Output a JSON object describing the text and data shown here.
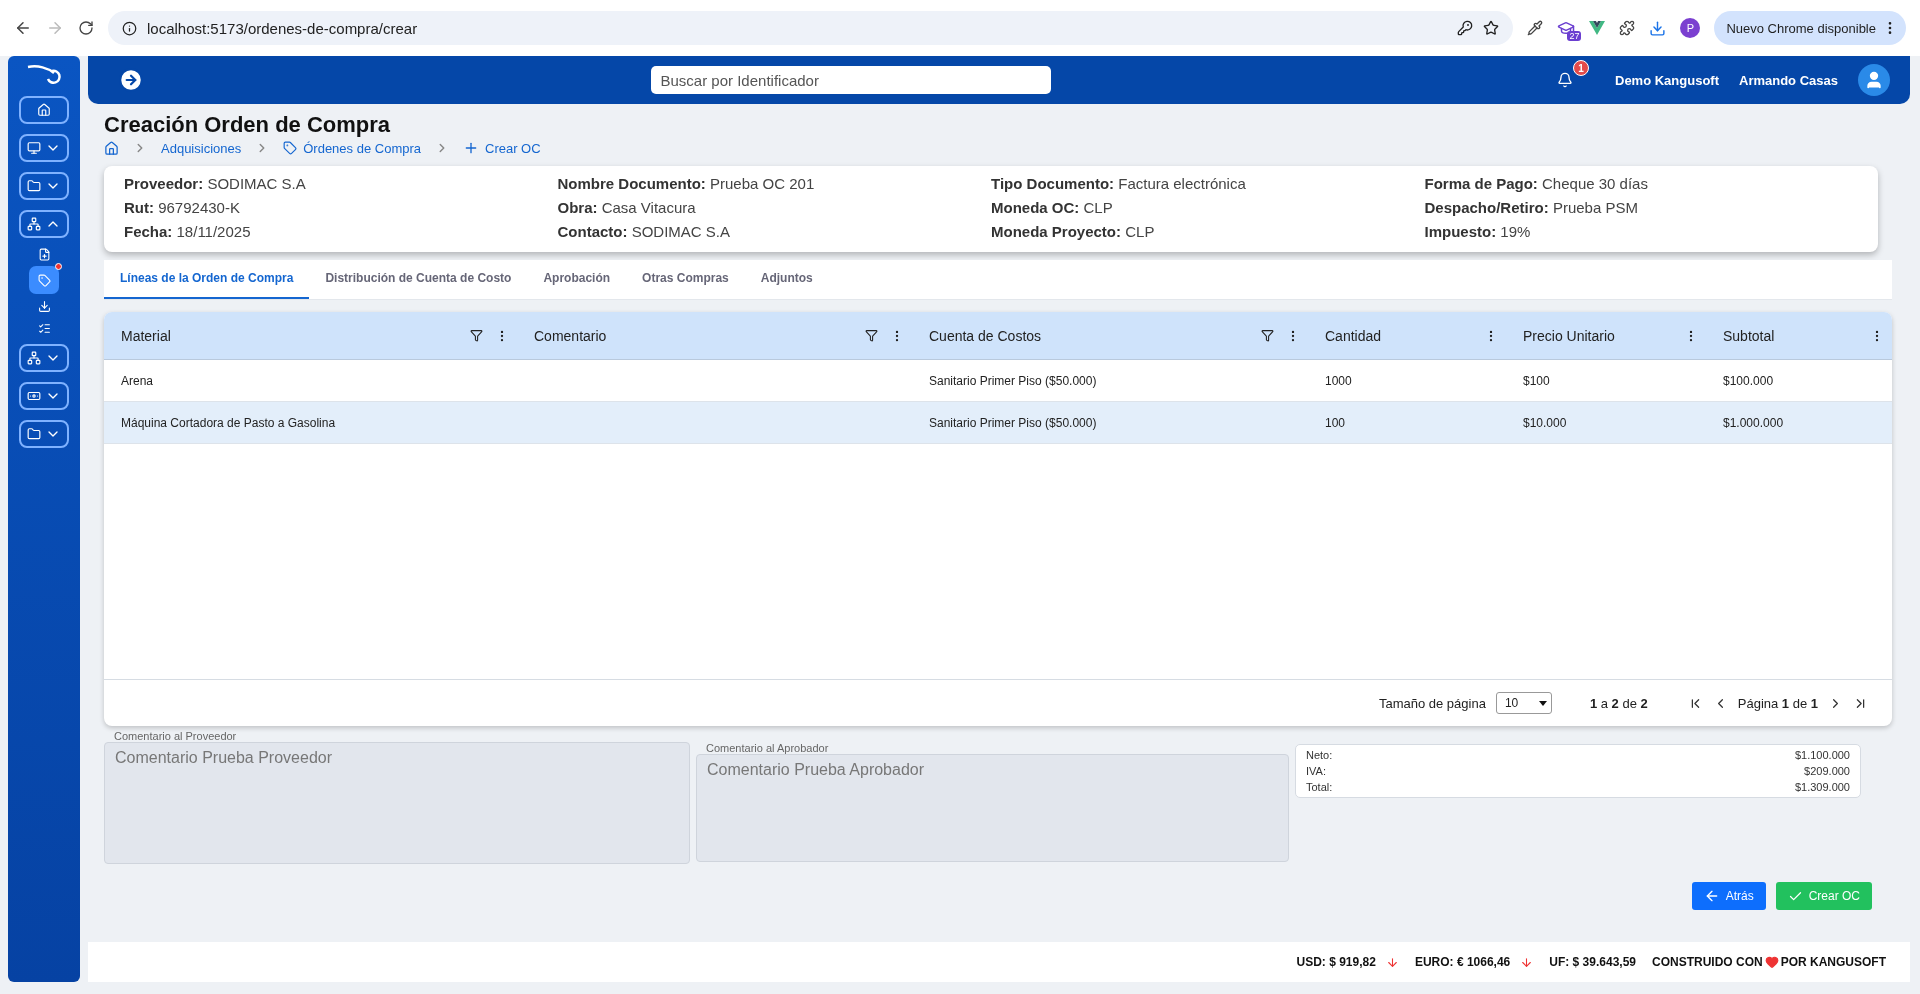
{
  "browser": {
    "url": "localhost:5173/ordenes-de-compra/crear",
    "extension_badge": "27",
    "profile": "P",
    "update_label": "Nuevo Chrome disponible"
  },
  "sidebar": {
    "items": [
      {
        "kind": "button",
        "selected": false,
        "badge": false
      },
      {
        "kind": "group",
        "expanded": false,
        "selected": false,
        "badge": false
      },
      {
        "kind": "group",
        "expanded": false,
        "selected": false,
        "badge": false
      },
      {
        "kind": "group",
        "expanded": true,
        "selected": false,
        "badge": false
      },
      {
        "kind": "link",
        "selected": false,
        "badge": false
      },
      {
        "kind": "link",
        "selected": true,
        "badge": true
      },
      {
        "kind": "link",
        "selected": false,
        "badge": false
      },
      {
        "kind": "link",
        "selected": false,
        "badge": false
      },
      {
        "kind": "group",
        "expanded": false,
        "selected": false,
        "badge": false
      },
      {
        "kind": "group",
        "expanded": false,
        "selected": false,
        "badge": false
      },
      {
        "kind": "group",
        "expanded": false,
        "selected": false,
        "badge": false
      }
    ]
  },
  "header": {
    "search_placeholder": "Buscar por Identificador",
    "notifications": "1",
    "company": "Demo Kangusoft",
    "user": "Armando Casas"
  },
  "title": "Creación Orden de Compra",
  "breadcrumb": [
    {
      "label": "Adquisiciones",
      "kind": "plain"
    },
    {
      "label": "Órdenes de Compra",
      "kind": "tag"
    },
    {
      "label": "Crear OC",
      "kind": "plus"
    }
  ],
  "info": [
    [
      {
        "label": "Proveedor:",
        "value": "SODIMAC S.A"
      },
      {
        "label": "Rut:",
        "value": "96792430-K"
      },
      {
        "label": "Fecha:",
        "value": "18/11/2025"
      }
    ],
    [
      {
        "label": "Nombre Documento:",
        "value": "Prueba OC 201"
      },
      {
        "label": "Obra:",
        "value": "Casa Vitacura"
      },
      {
        "label": "Contacto:",
        "value": "SODIMAC S.A"
      }
    ],
    [
      {
        "label": "Tipo Documento:",
        "value": "Factura electrónica"
      },
      {
        "label": "Moneda OC:",
        "value": "CLP"
      },
      {
        "label": "Moneda Proyecto:",
        "value": "CLP"
      }
    ],
    [
      {
        "label": "Forma de Pago:",
        "value": "Cheque 30 días"
      },
      {
        "label": "Despacho/Retiro:",
        "value": "Prueba PSM"
      },
      {
        "label": "Impuesto:",
        "value": "19%"
      }
    ]
  ],
  "tabs": [
    {
      "label": "Líneas de la Orden de Compra",
      "selected": true
    },
    {
      "label": "Distribución de Cuenta de Costo",
      "selected": false
    },
    {
      "label": "Aprobación",
      "selected": false
    },
    {
      "label": "Otras Compras",
      "selected": false
    },
    {
      "label": "Adjuntos",
      "selected": false
    }
  ],
  "table": {
    "columns": [
      {
        "label": "Material",
        "filter": true
      },
      {
        "label": "Comentario",
        "filter": true
      },
      {
        "label": "Cuenta de Costos",
        "filter": true
      },
      {
        "label": "Cantidad",
        "filter": false
      },
      {
        "label": "Precio Unitario",
        "filter": false
      },
      {
        "label": "Subtotal",
        "filter": false
      }
    ],
    "rows": [
      {
        "selected": false,
        "cells": [
          "Arena",
          "",
          "Sanitario Primer Piso ($50.000)",
          "1000",
          "$100",
          "$100.000"
        ]
      },
      {
        "selected": true,
        "cells": [
          "Máquina Cortadora de Pasto a Gasolina",
          "",
          "Sanitario Primer Piso ($50.000)",
          "100",
          "$10.000",
          "$1.000.000"
        ]
      }
    ]
  },
  "pagination": {
    "page_size_label": "Tamaño de página",
    "page_size": "10",
    "range": "**1** a **2** de **2**",
    "page": "Página **1** de **1**"
  },
  "comments": [
    {
      "label": "Comentario al Proveedor",
      "value": "Comentario Prueba Proveedor",
      "disabled": true
    },
    {
      "label": "Comentario al Aprobador",
      "value": "Comentario Prueba Aprobador",
      "disabled": true
    }
  ],
  "totals": [
    {
      "label": "Neto:",
      "value": "$1.100.000"
    },
    {
      "label": "IVA:",
      "value": "$209.000"
    },
    {
      "label": "Total:",
      "value": "$1.309.000"
    }
  ],
  "buttons": [
    {
      "label": "Atrás",
      "kind": "back"
    },
    {
      "label": "Crear OC",
      "kind": "confirm"
    }
  ],
  "footer": {
    "rates": [
      {
        "label": "USD: $ 919,82",
        "falling": true
      },
      {
        "label": "EURO: € 1066,46",
        "falling": true
      },
      {
        "label": "UF: $ 39.643,59",
        "falling": false
      }
    ],
    "credit_before": "CONSTRUIDO CON",
    "credit_after": "POR KANGUSOFT"
  }
}
